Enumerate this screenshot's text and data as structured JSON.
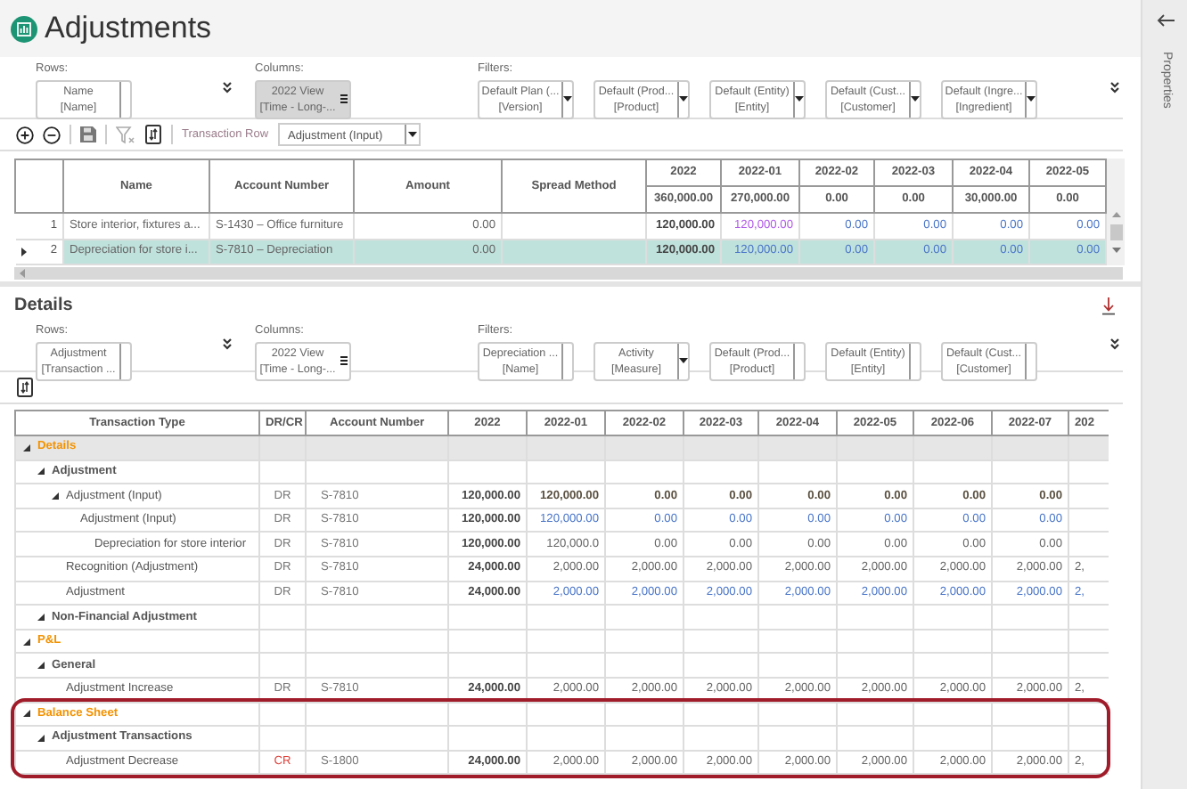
{
  "app": {
    "title": "Adjustments"
  },
  "sidebar": {
    "label": "Properties"
  },
  "main_pivot": {
    "rows_label": "Rows:",
    "rows": [
      {
        "line1": "Name",
        "line2": "[Name]"
      }
    ],
    "columns_label": "Columns:",
    "columns": [
      {
        "line1": "2022 View",
        "line2": "[Time - Long-...",
        "shaded": true
      }
    ],
    "filters_label": "Filters:",
    "filters": [
      {
        "line1": "Default Plan (...",
        "line2": "[Version]",
        "dropdown": true
      },
      {
        "line1": "Default (Prod...",
        "line2": "[Product]",
        "dropdown": true
      },
      {
        "line1": "Default (Entity)",
        "line2": "[Entity]",
        "dropdown": true
      },
      {
        "line1": "Default (Cust...",
        "line2": "[Customer]",
        "dropdown": true
      },
      {
        "line1": "Default (Ingre...",
        "line2": "[Ingredient]",
        "dropdown": true
      }
    ]
  },
  "toolbar": {
    "label": "Transaction Row",
    "value": "Adjustment (Input)"
  },
  "input_grid": {
    "columns": [
      "Name",
      "Account Number",
      "Amount",
      "Spread Method"
    ],
    "periods": [
      "2022",
      "2022-01",
      "2022-02",
      "2022-03",
      "2022-04",
      "2022-05"
    ],
    "totals": [
      "360,000.00",
      "270,000.00",
      "0.00",
      "0.00",
      "30,000.00",
      "0.00"
    ],
    "rows": [
      {
        "number": "1",
        "name": "Store interior, fixtures a...",
        "account": "S-1430 – Office furniture",
        "amount": "0.00",
        "selected": false,
        "cells": [
          {
            "text": "120,000.00",
            "kind": "total"
          },
          {
            "text": "120,000.00",
            "kind": "changed"
          },
          {
            "text": "0.00",
            "kind": "input"
          },
          {
            "text": "0.00",
            "kind": "input"
          },
          {
            "text": "0.00",
            "kind": "input"
          },
          {
            "text": "0.00",
            "kind": "input"
          }
        ]
      },
      {
        "number": "2",
        "name": "Depreciation for store i...",
        "account": "S-7810 – Depreciation",
        "amount": "0.00",
        "selected": true,
        "cells": [
          {
            "text": "120,000.00",
            "kind": "total"
          },
          {
            "text": "120,000.00",
            "kind": "input"
          },
          {
            "text": "0.00",
            "kind": "input"
          },
          {
            "text": "0.00",
            "kind": "input"
          },
          {
            "text": "0.00",
            "kind": "input"
          },
          {
            "text": "0.00",
            "kind": "input"
          }
        ]
      }
    ]
  },
  "details": {
    "title": "Details",
    "pivot": {
      "rows_label": "Rows:",
      "rows": [
        {
          "line1": "Adjustment",
          "line2": "[Transaction ..."
        }
      ],
      "columns_label": "Columns:",
      "columns": [
        {
          "line1": "2022 View",
          "line2": "[Time - Long-...",
          "shaded": false
        }
      ],
      "filters_label": "Filters:",
      "filters": [
        {
          "line1": "Depreciation ...",
          "line2": "[Name]",
          "dropdown": false
        },
        {
          "line1": "Activity",
          "line2": "[Measure]",
          "dropdown": true
        },
        {
          "line1": "Default (Prod...",
          "line2": "[Product]",
          "dropdown": false
        },
        {
          "line1": "Default (Entity)",
          "line2": "[Entity]",
          "dropdown": false
        },
        {
          "line1": "Default (Cust...",
          "line2": "[Customer]",
          "dropdown": false
        }
      ]
    },
    "grid": {
      "columns": [
        "Transaction Type",
        "DR/CR",
        "Account Number",
        "2022",
        "2022-01",
        "2022-02",
        "2022-03",
        "2022-04",
        "2022-05",
        "2022-06",
        "2022-07",
        "202"
      ],
      "rows": [
        {
          "label": "Details",
          "kind": "section",
          "expanded": true,
          "selected": true,
          "highlighted": false,
          "children": [
            {
              "label": "Adjustment",
              "kind": "group",
              "expanded": true,
              "selected": false,
              "highlighted": false,
              "children": [
                {
                  "label": "Adjustment (Input)",
                  "kind": "total",
                  "expanded": true,
                  "selected": false,
                  "highlighted": false,
                  "dr_cr": {
                    "text": "DR",
                    "kind": "debit"
                  },
                  "account": "S-7810",
                  "values": [
                    "120,000.00",
                    "120,000.00",
                    "0.00",
                    "0.00",
                    "0.00",
                    "0.00",
                    "0.00",
                    "0.00"
                  ],
                  "children": [
                    {
                      "label": "Adjustment (Input)",
                      "kind": "input",
                      "selected": false,
                      "highlighted": false,
                      "dr_cr": {
                        "text": "DR",
                        "kind": "debit"
                      },
                      "account": "S-7810",
                      "values": [
                        "120,000.00",
                        "120,000.00",
                        "0.00",
                        "0.00",
                        "0.00",
                        "0.00",
                        "0.00",
                        "0.00"
                      ],
                      "children": [
                        {
                          "label": "Depreciation for store interior",
                          "kind": "derived",
                          "selected": false,
                          "highlighted": false,
                          "dr_cr": {
                            "text": "DR",
                            "kind": "debit"
                          },
                          "account": "S-7810",
                          "values": [
                            "120,000.00",
                            "120,000.0",
                            "0.00",
                            "0.00",
                            "0.00",
                            "0.00",
                            "0.00",
                            "0.00"
                          ]
                        }
                      ]
                    }
                  ]
                },
                {
                  "label": "Recognition (Adjustment)",
                  "kind": "derived",
                  "selected": false,
                  "highlighted": false,
                  "dr_cr": {
                    "text": "DR",
                    "kind": "debit"
                  },
                  "account": "S-7810",
                  "values": [
                    "24,000.00",
                    "2,000.00",
                    "2,000.00",
                    "2,000.00",
                    "2,000.00",
                    "2,000.00",
                    "2,000.00",
                    "2,000.00",
                    "2,"
                  ]
                },
                {
                  "label": "Adjustment",
                  "kind": "input",
                  "selected": false,
                  "highlighted": false,
                  "dr_cr": {
                    "text": "DR",
                    "kind": "debit"
                  },
                  "account": "S-7810",
                  "values": [
                    "24,000.00",
                    "2,000.00",
                    "2,000.00",
                    "2,000.00",
                    "2,000.00",
                    "2,000.00",
                    "2,000.00",
                    "2,000.00",
                    "2,"
                  ]
                }
              ]
            },
            {
              "label": "Non-Financial Adjustment",
              "kind": "group",
              "expanded": true,
              "selected": false,
              "highlighted": false
            }
          ]
        },
        {
          "label": "P&L",
          "kind": "section",
          "expanded": true,
          "selected": false,
          "highlighted": false,
          "children": [
            {
              "label": "General",
              "kind": "group",
              "expanded": true,
              "selected": false,
              "highlighted": false,
              "children": [
                {
                  "label": "Adjustment Increase",
                  "kind": "derived",
                  "selected": false,
                  "highlighted": false,
                  "dr_cr": {
                    "text": "DR",
                    "kind": "debit"
                  },
                  "account": "S-7810",
                  "values": [
                    "24,000.00",
                    "2,000.00",
                    "2,000.00",
                    "2,000.00",
                    "2,000.00",
                    "2,000.00",
                    "2,000.00",
                    "2,000.00",
                    "2,"
                  ]
                }
              ]
            }
          ]
        },
        {
          "label": "Balance Sheet",
          "kind": "section",
          "expanded": true,
          "selected": false,
          "highlighted": true,
          "children": [
            {
              "label": "Adjustment Transactions",
              "kind": "group",
              "expanded": true,
              "selected": false,
              "highlighted": true,
              "children": [
                {
                  "label": "Adjustment Decrease",
                  "kind": "derived",
                  "selected": false,
                  "highlighted": true,
                  "dr_cr": {
                    "text": "CR",
                    "kind": "credit"
                  },
                  "account": "S-1800",
                  "values": [
                    "24,000.00",
                    "2,000.00",
                    "2,000.00",
                    "2,000.00",
                    "2,000.00",
                    "2,000.00",
                    "2,000.00",
                    "2,000.00",
                    "2,"
                  ]
                }
              ]
            }
          ]
        }
      ]
    }
  }
}
